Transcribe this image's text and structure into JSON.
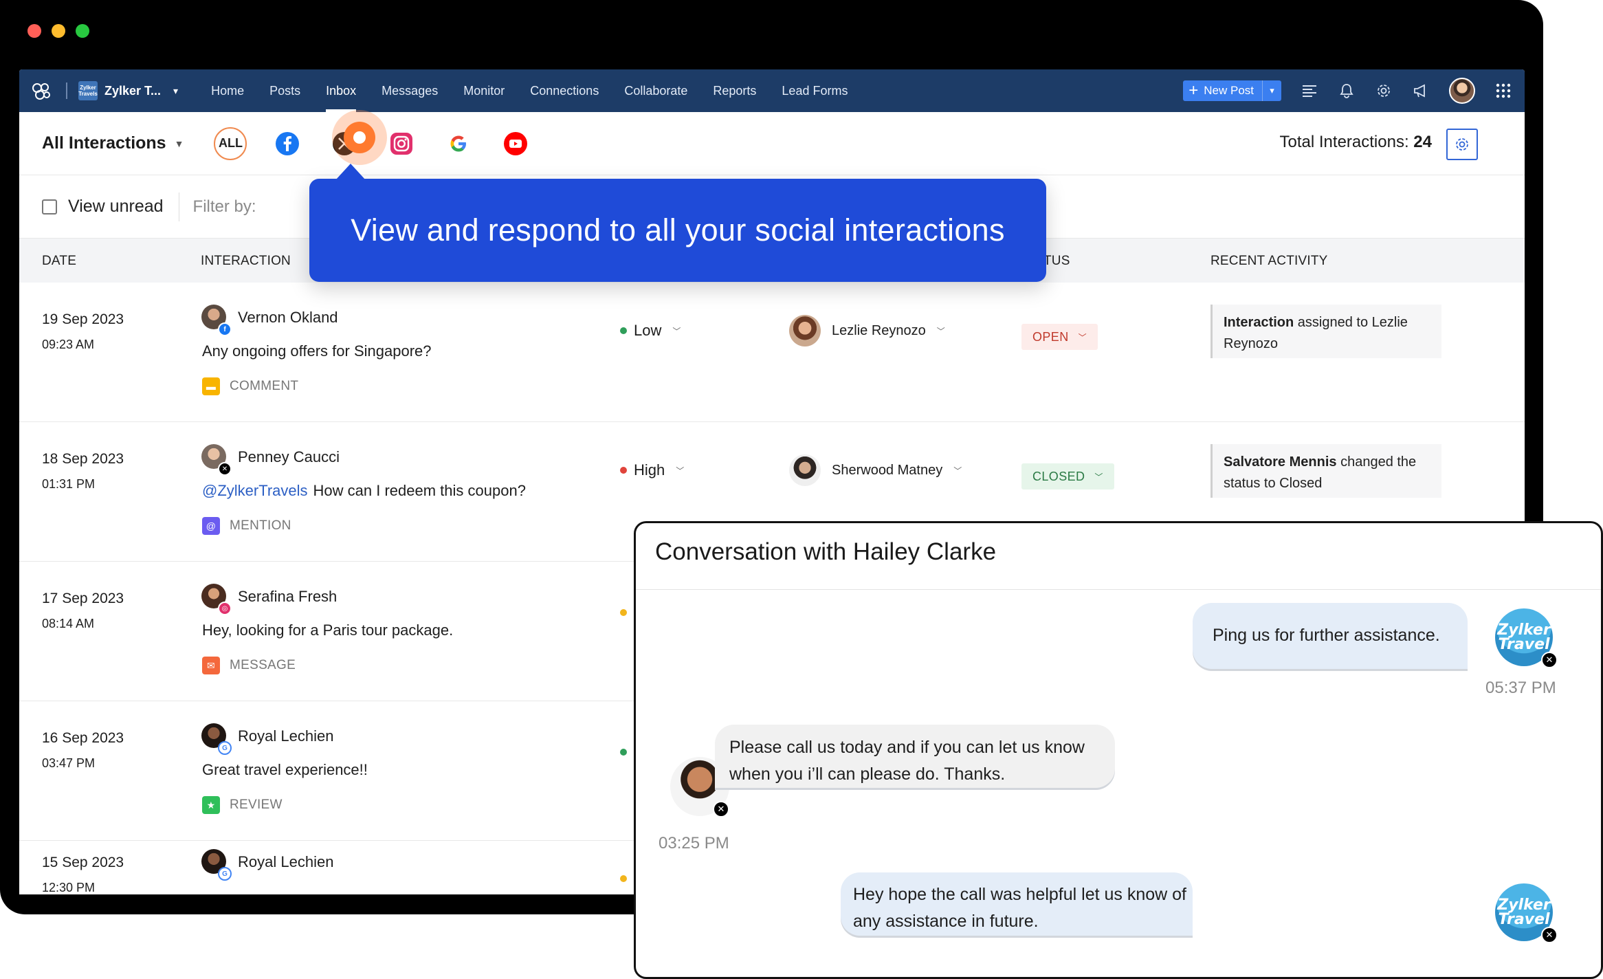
{
  "window": {
    "traffic_colors": [
      "#ff5f57",
      "#febc2e",
      "#28c840"
    ]
  },
  "topnav": {
    "brand_name": "Zylker T...",
    "brand_logo_text": "Zylker Travels",
    "menu": [
      "Home",
      "Posts",
      "Inbox",
      "Messages",
      "Monitor",
      "Connections",
      "Collaborate",
      "Reports",
      "Lead Forms"
    ],
    "active": "Inbox",
    "new_post_label": "New Post",
    "icons": [
      "menu-lines-icon",
      "bell-icon",
      "gear-icon",
      "megaphone-icon",
      "user-avatar",
      "apps-grid-icon"
    ]
  },
  "subheader": {
    "view_label": "All Interactions",
    "channels": [
      "ALL",
      "facebook",
      "x",
      "instagram",
      "google",
      "youtube"
    ],
    "channel_all_label": "ALL",
    "total_label": "Total Interactions:",
    "total_count": "24"
  },
  "filter": {
    "view_unread": "View unread",
    "filter_by": "Filter by:"
  },
  "table": {
    "headers": {
      "date": "DATE",
      "interaction": "INTERACTION",
      "status": "TUS",
      "recent_activity": "RECENT ACTIVITY"
    },
    "rows": [
      {
        "date": "19 Sep 2023",
        "time": "09:23 AM",
        "name": "Vernon Okland",
        "network": "facebook",
        "message": "Any ongoing offers for Singapore?",
        "mention": "",
        "type": "COMMENT",
        "priority": "Low",
        "assignee": "Lezlie Reynozo",
        "status": "OPEN",
        "activity_bold": "Interaction",
        "activity_rest": " assigned to Lezlie Reynozo"
      },
      {
        "date": "18 Sep 2023",
        "time": "01:31 PM",
        "name": "Penney Caucci",
        "network": "x",
        "message": "How can I redeem this coupon?",
        "mention": "@ZylkerTravels",
        "type": "MENTION",
        "priority": "High",
        "assignee": "Sherwood Matney",
        "status": "CLOSED",
        "activity_bold": "Salvatore Mennis",
        "activity_rest": " changed the status to Closed"
      },
      {
        "date": "17 Sep 2023",
        "time": "08:14 AM",
        "name": "Serafina Fresh",
        "network": "instagram",
        "message": "Hey, looking for a Paris tour package.",
        "type": "MESSAGE"
      },
      {
        "date": "16 Sep 2023",
        "time": "03:47 PM",
        "name": "Royal Lechien",
        "network": "google",
        "message": "Great travel experience!!",
        "type": "REVIEW"
      },
      {
        "date": "15 Sep 2023",
        "time": "12:30 PM",
        "name": "Royal Lechien",
        "network": "google"
      }
    ]
  },
  "tooltip": {
    "text": "View and respond to all your social interactions"
  },
  "conversation": {
    "title": "Conversation with Hailey Clarke",
    "brand_avatar_text": "Zylker Travel",
    "messages": [
      {
        "direction": "out",
        "text": "Ping us for further assistance.",
        "time": "05:37 PM"
      },
      {
        "direction": "in",
        "text": "Please call us today and if you can let us know when you i’ll can please do. Thanks.",
        "time": "03:25 PM"
      },
      {
        "direction": "out",
        "text": "Hey hope the call was helpful let us know of any assistance in future."
      }
    ]
  },
  "colors": {
    "nav": "#1d3c67",
    "accent": "#1f4bd8",
    "pulse": "#ff7a2f",
    "low": "#2f9e5a",
    "high": "#e0443b",
    "medium": "#f2b51c"
  }
}
